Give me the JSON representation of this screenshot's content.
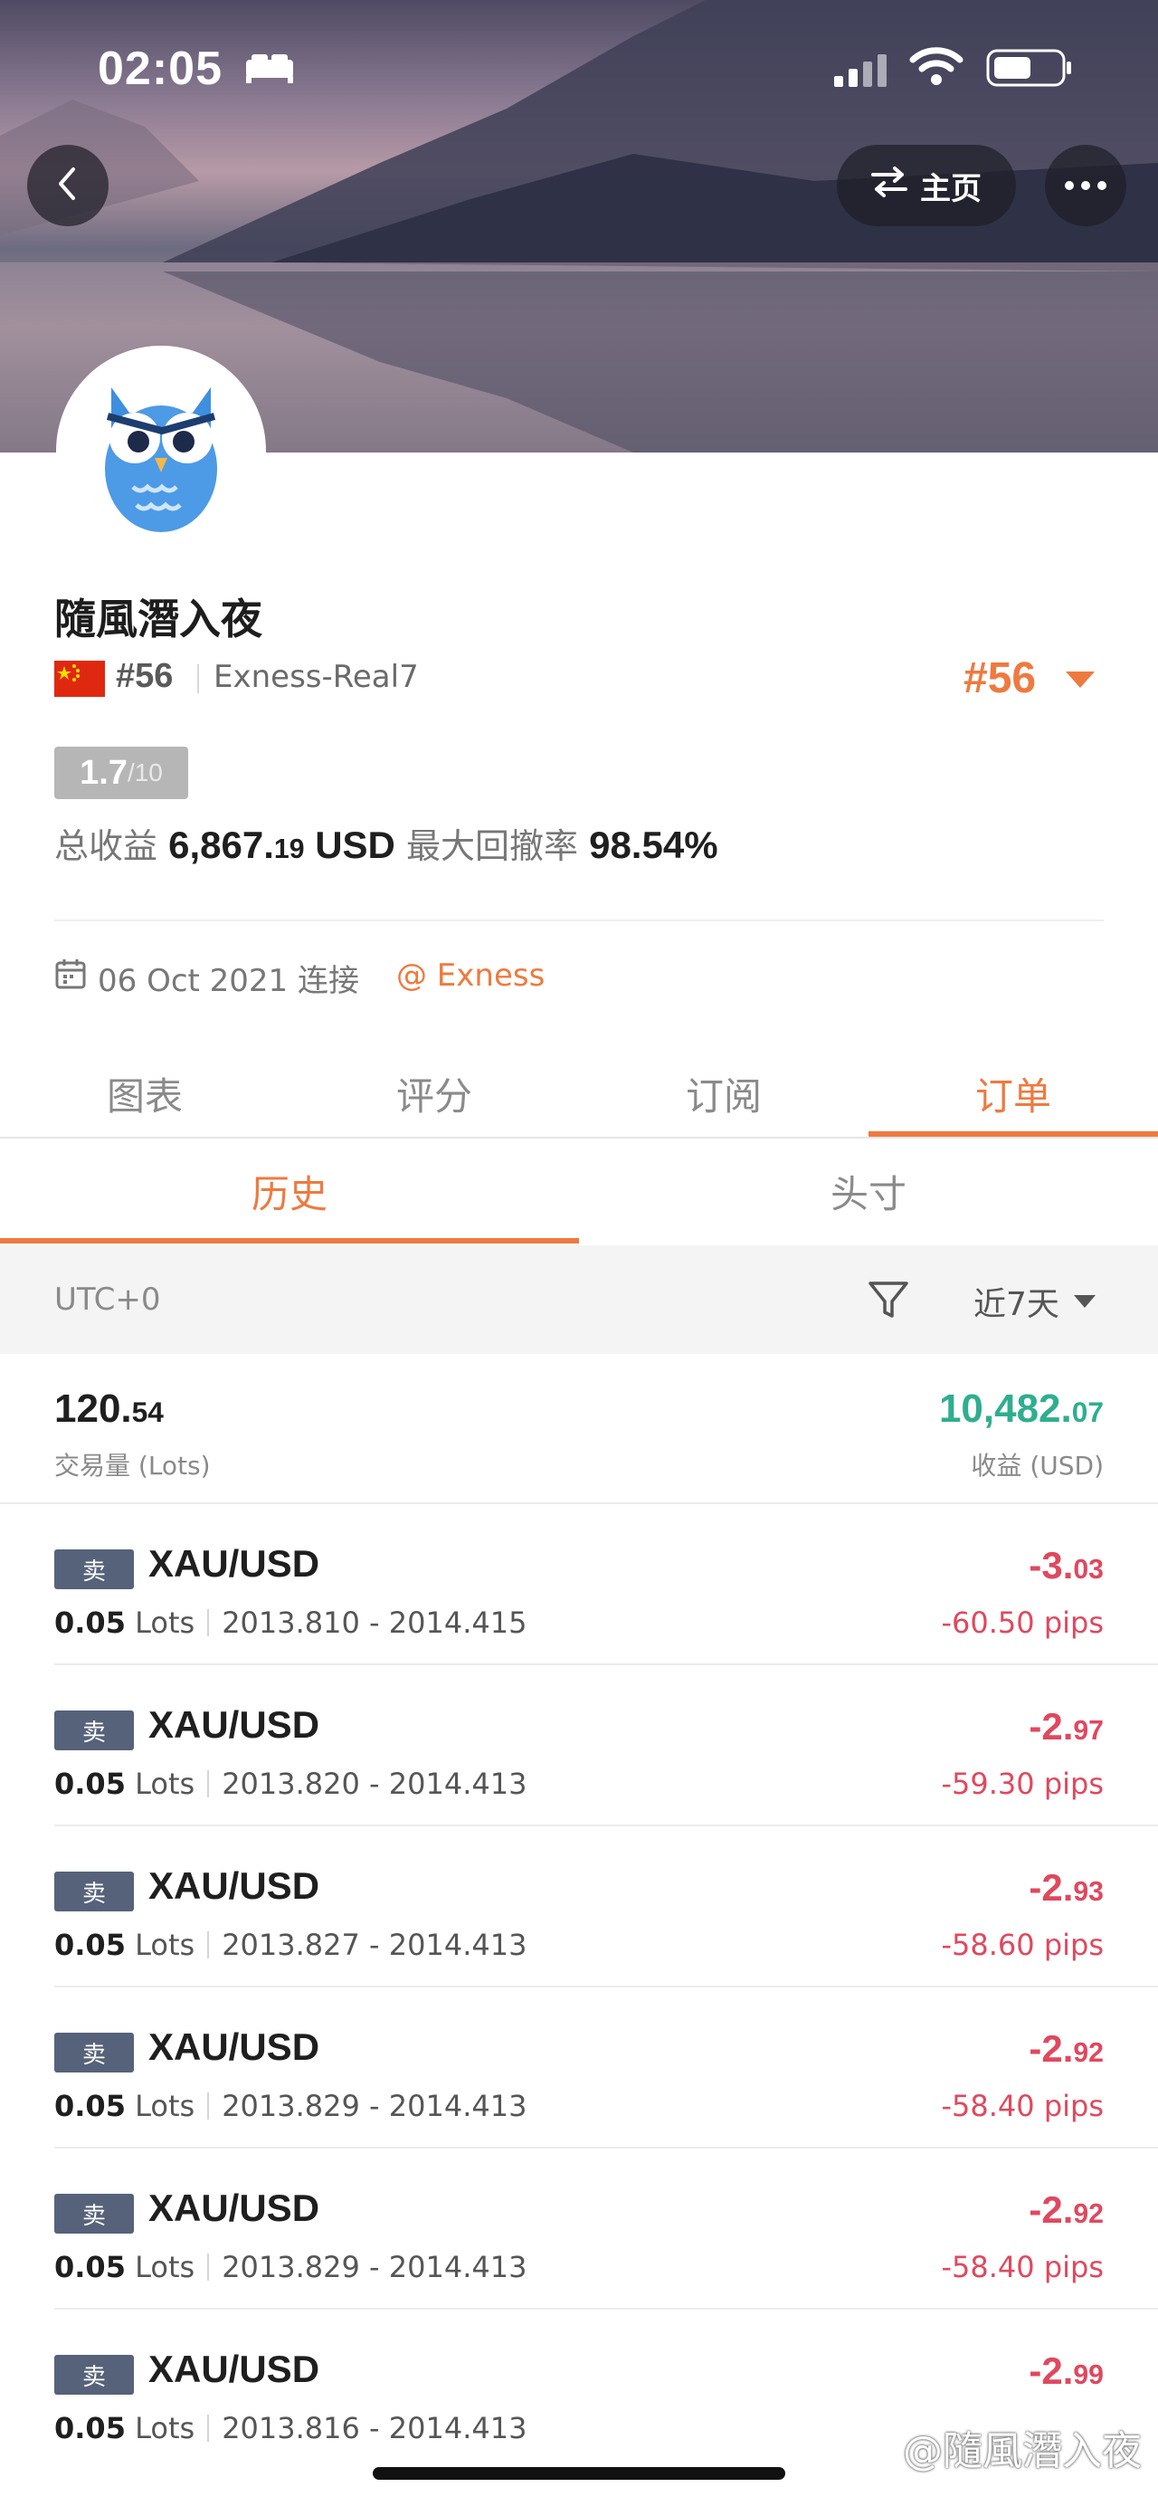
{
  "status_bar": {
    "time": "02:05"
  },
  "header": {
    "home_label": "主页"
  },
  "profile": {
    "name": "隨風潛入夜",
    "rank_small": "#56",
    "server": "Exness-Real7",
    "rank_big": "#56",
    "score": "1.7",
    "score_max": "/10",
    "total_profit_label": "总收益",
    "total_profit_value": "6,867.",
    "total_profit_decimals": "19",
    "total_profit_currency": "USD",
    "max_drawdown_label": "最大回撤率",
    "max_drawdown_value": "98.54%",
    "connect_date": "06 Oct 2021 连接",
    "broker": "@ Exness"
  },
  "tabs": [
    {
      "label": "图表"
    },
    {
      "label": "评分"
    },
    {
      "label": "订阅"
    },
    {
      "label": "订单"
    }
  ],
  "sub_tabs": [
    {
      "label": "历史"
    },
    {
      "label": "头寸"
    }
  ],
  "filter": {
    "timezone": "UTC+0",
    "period": "近7天"
  },
  "summary": {
    "volume_int": "120.",
    "volume_dec": "54",
    "volume_label": "交易量 (Lots)",
    "profit_int": "10,482.",
    "profit_dec": "07",
    "profit_label": "收益 (USD)"
  },
  "orders": [
    {
      "type": "卖",
      "symbol": "XAU/USD",
      "lots": "0.05",
      "lots_unit": "Lots",
      "prices": "2013.810 - 2014.415",
      "pl_int": "-3.",
      "pl_dec": "03",
      "pips": "-60.50 pips"
    },
    {
      "type": "卖",
      "symbol": "XAU/USD",
      "lots": "0.05",
      "lots_unit": "Lots",
      "prices": "2013.820 - 2014.413",
      "pl_int": "-2.",
      "pl_dec": "97",
      "pips": "-59.30 pips"
    },
    {
      "type": "卖",
      "symbol": "XAU/USD",
      "lots": "0.05",
      "lots_unit": "Lots",
      "prices": "2013.827 - 2014.413",
      "pl_int": "-2.",
      "pl_dec": "93",
      "pips": "-58.60 pips"
    },
    {
      "type": "卖",
      "symbol": "XAU/USD",
      "lots": "0.05",
      "lots_unit": "Lots",
      "prices": "2013.829 - 2014.413",
      "pl_int": "-2.",
      "pl_dec": "92",
      "pips": "-58.40 pips"
    },
    {
      "type": "卖",
      "symbol": "XAU/USD",
      "lots": "0.05",
      "lots_unit": "Lots",
      "prices": "2013.829 - 2014.413",
      "pl_int": "-2.",
      "pl_dec": "92",
      "pips": "-58.40 pips"
    },
    {
      "type": "卖",
      "symbol": "XAU/USD",
      "lots": "0.05",
      "lots_unit": "Lots",
      "prices": "2013.816 - 2014.413",
      "pl_int": "-2.",
      "pl_dec": "99",
      "pips": ""
    }
  ],
  "watermark": "@隨風潛入夜",
  "colors": {
    "accent": "#ee7a3f",
    "profit": "#2fae8f",
    "loss": "#e0485e",
    "sell_badge": "#56627a"
  },
  "icons": [
    "back-arrow-icon",
    "swap-icon",
    "more-icon",
    "calendar-icon",
    "filter-icon",
    "chevron-down-icon",
    "bed-icon",
    "signal-icon",
    "wifi-icon",
    "battery-icon"
  ]
}
